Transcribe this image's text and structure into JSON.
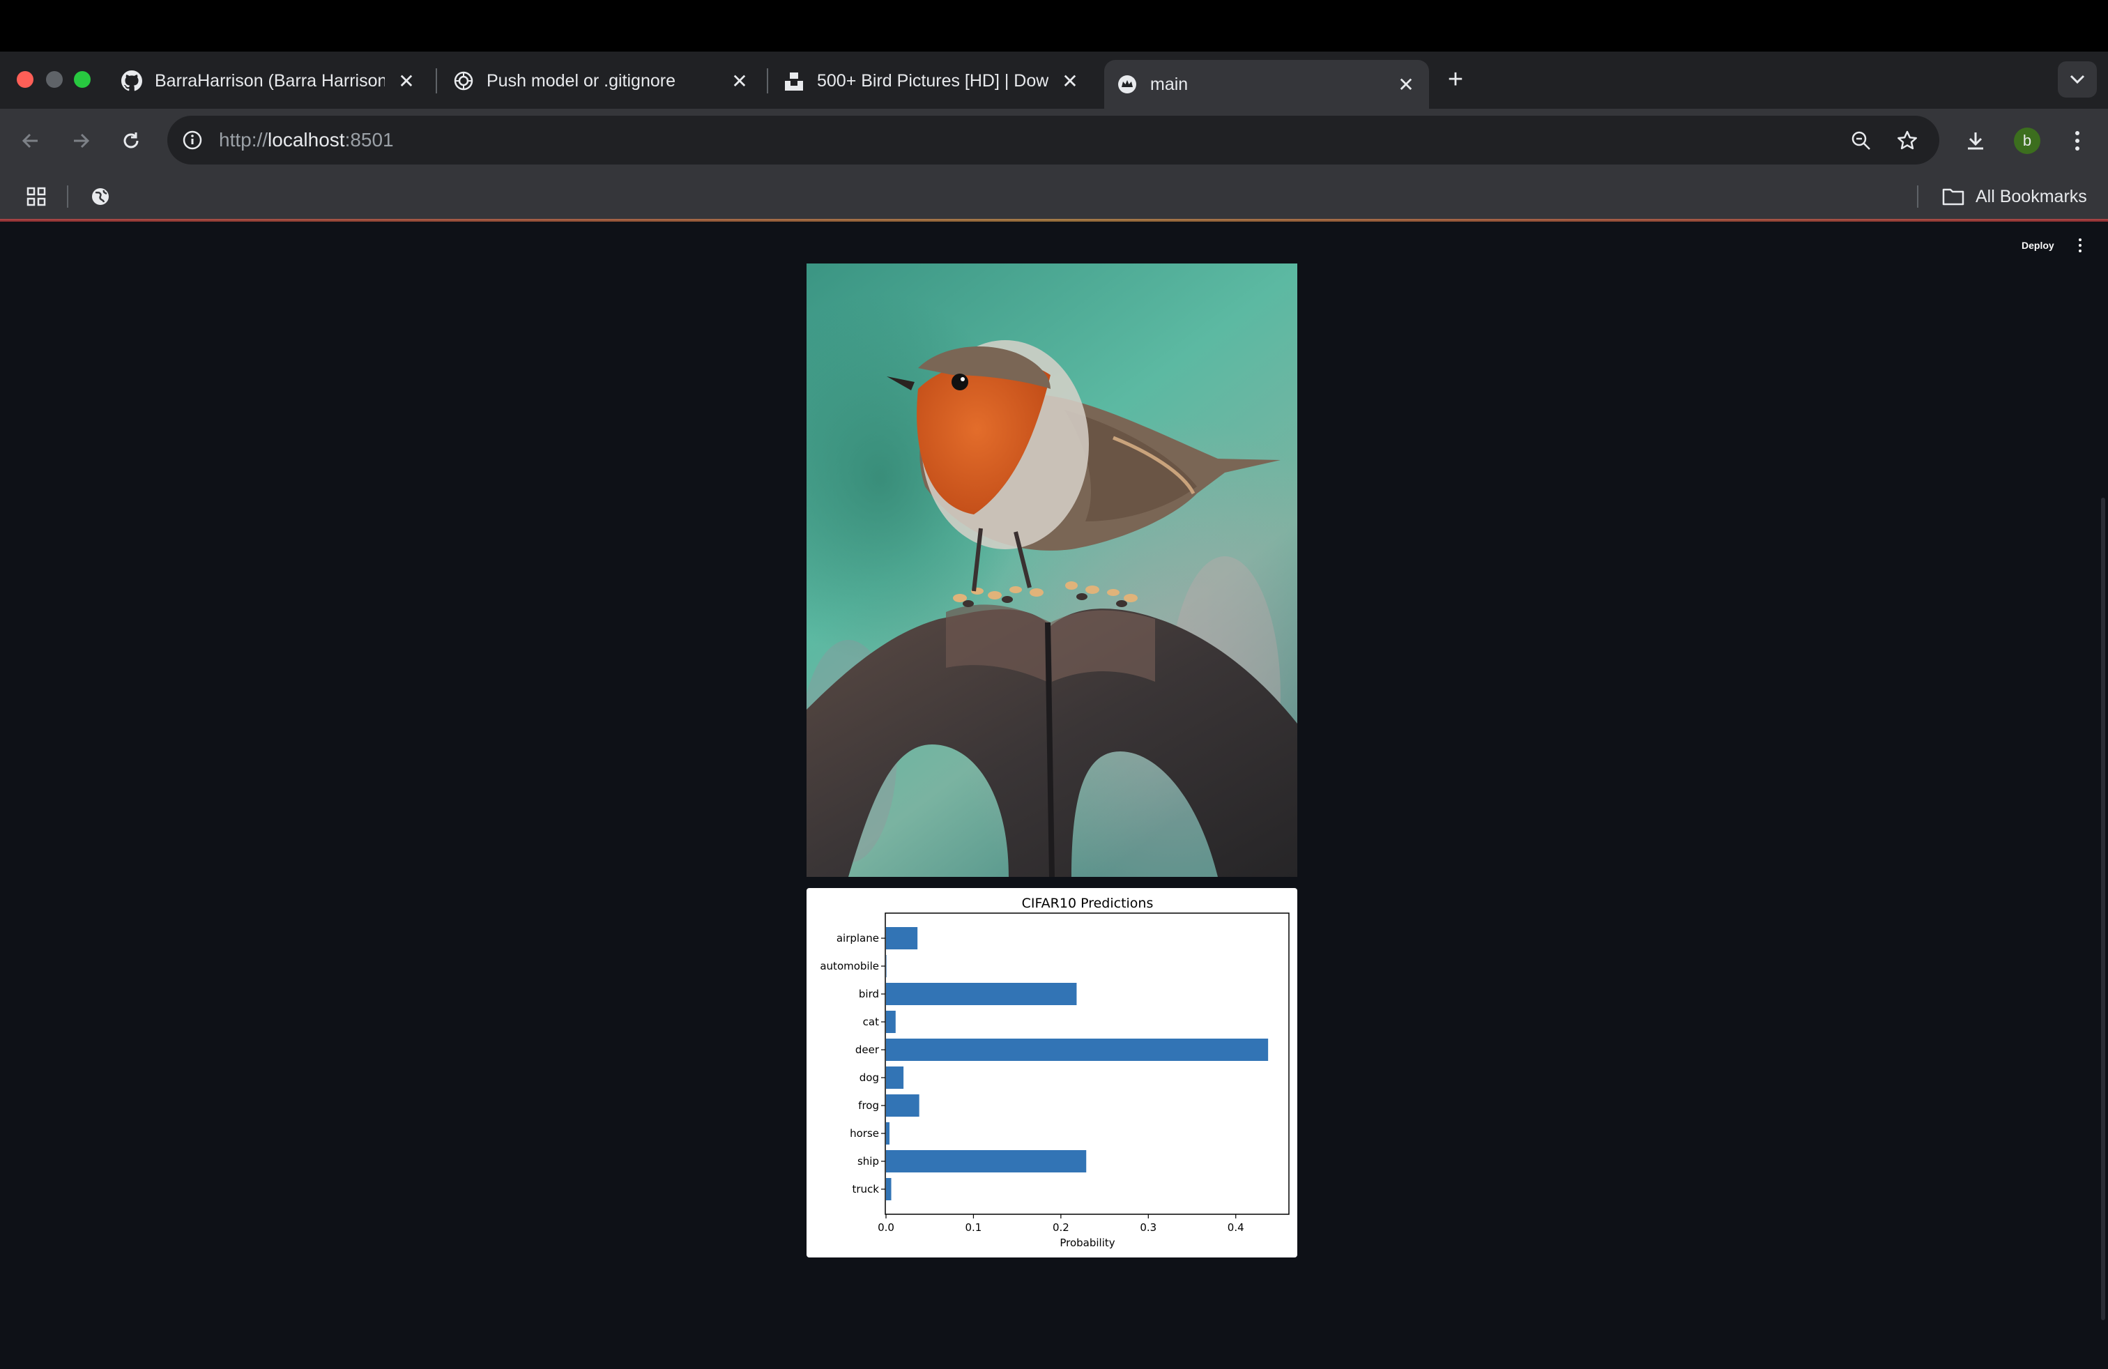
{
  "browser": {
    "tabs": [
      {
        "title": "BarraHarrison (Barra Harrison",
        "favicon": "github-icon",
        "active": false
      },
      {
        "title": "Push model or .gitignore",
        "favicon": "chatgpt-icon",
        "active": false
      },
      {
        "title": "500+ Bird Pictures [HD] | Dow",
        "favicon": "unsplash-icon",
        "active": false
      },
      {
        "title": "main",
        "favicon": "streamlit-crown-icon",
        "active": true
      }
    ],
    "url": {
      "scheme": "http://",
      "host": "localhost",
      "port": ":8501"
    },
    "profile_initial": "b",
    "bookmarks_label": "All Bookmarks",
    "colors": {
      "profile": "#3c6e1e",
      "close_light": "#ff5f57",
      "minimize_light": "#5f6368",
      "zoom_light": "#28c840"
    }
  },
  "app": {
    "deploy_label": "Deploy",
    "bar_color": "#3274b5"
  },
  "chart_data": {
    "type": "bar",
    "orientation": "horizontal",
    "title": "CIFAR10 Predictions",
    "xlabel": "Probability",
    "ylabel": "",
    "categories": [
      "airplane",
      "automobile",
      "bird",
      "cat",
      "deer",
      "dog",
      "frog",
      "horse",
      "ship",
      "truck"
    ],
    "values": [
      0.036,
      0.0005,
      0.218,
      0.011,
      0.437,
      0.02,
      0.038,
      0.004,
      0.229,
      0.006
    ],
    "xlim": [
      0,
      0.46
    ],
    "xticks": [
      "0.0",
      "0.1",
      "0.2",
      "0.3",
      "0.4"
    ],
    "xtick_values": [
      0,
      0.1,
      0.2,
      0.3,
      0.4
    ],
    "grid": false
  }
}
